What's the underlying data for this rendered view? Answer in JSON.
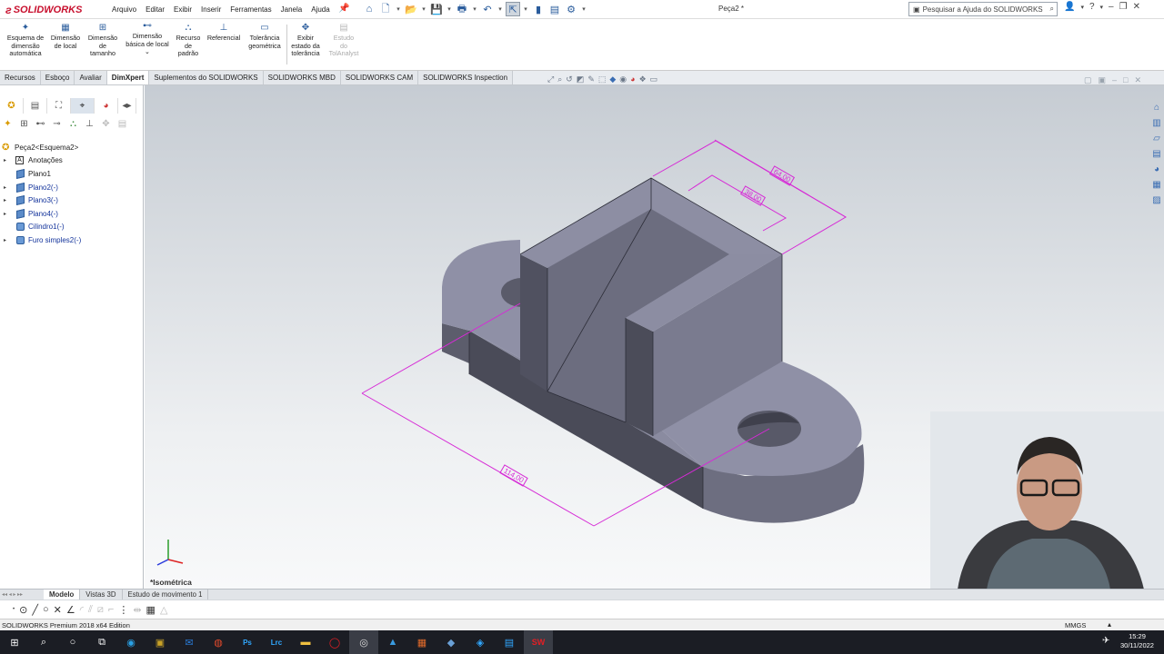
{
  "app": {
    "brand": "SOLIDWORKS",
    "doc_title": "Peça2 *",
    "search_placeholder": "Pesquisar a Ajuda do SOLIDWORKS"
  },
  "menus": [
    "Arquivo",
    "Editar",
    "Exibir",
    "Inserir",
    "Ferramentas",
    "Janela",
    "Ajuda"
  ],
  "commands": [
    {
      "label": "Esquema de dimensão automática",
      "lines": [
        "Esquema de",
        "dimensão",
        "automática"
      ],
      "icon": "auto-dimension-icon",
      "enabled": true
    },
    {
      "label": "Dimensão de local",
      "lines": [
        "Dimensão",
        "de local"
      ],
      "icon": "location-dimension-icon",
      "enabled": true
    },
    {
      "label": "Dimensão de tamanho",
      "lines": [
        "Dimensão",
        "de",
        "tamanho"
      ],
      "icon": "size-dimension-icon",
      "enabled": true
    },
    {
      "label": "Dimensão básica de local",
      "lines": [
        "Dimensão",
        "básica de local"
      ],
      "icon": "basic-location-dimension-icon",
      "enabled": true
    },
    {
      "label": "Recurso de padrão",
      "lines": [
        "Recurso",
        "de",
        "padrão"
      ],
      "icon": "pattern-feature-icon",
      "enabled": true
    },
    {
      "label": "Referencial",
      "lines": [
        "Referencial"
      ],
      "icon": "datum-icon",
      "enabled": true
    },
    {
      "label": "Tolerância geométrica",
      "lines": [
        "Tolerância",
        "geométrica"
      ],
      "icon": "geometric-tolerance-icon",
      "enabled": true
    },
    {
      "label": "Exibir estado da tolerância",
      "lines": [
        "Exibir",
        "estado da",
        "tolerância"
      ],
      "icon": "tolerance-status-icon",
      "enabled": true
    },
    {
      "label": "Estudo do TolAnalyst",
      "lines": [
        "Estudo",
        "do",
        "TolAnalyst"
      ],
      "icon": "tolanalyst-icon",
      "enabled": false
    }
  ],
  "tabs": [
    {
      "label": "Recursos",
      "active": false
    },
    {
      "label": "Esboço",
      "active": false
    },
    {
      "label": "Avaliar",
      "active": false
    },
    {
      "label": "DimXpert",
      "active": true
    },
    {
      "label": "Suplementos do SOLIDWORKS",
      "active": false
    },
    {
      "label": "SOLIDWORKS MBD",
      "active": false
    },
    {
      "label": "SOLIDWORKS CAM",
      "active": false
    },
    {
      "label": "SOLIDWORKS Inspection",
      "active": false
    }
  ],
  "tree": {
    "root": "Peça2<Esquema2>",
    "items": [
      {
        "label": "Anotações",
        "icon": "annotations-icon",
        "expandable": true
      },
      {
        "label": "Plano1",
        "icon": "plane-icon",
        "expandable": false
      },
      {
        "label": "Plano2(-)",
        "icon": "plane-icon",
        "expandable": true
      },
      {
        "label": "Plano3(-)",
        "icon": "plane-icon",
        "expandable": true
      },
      {
        "label": "Plano4(-)",
        "icon": "plane-icon",
        "expandable": true
      },
      {
        "label": "Cilindro1(-)",
        "icon": "cylinder-icon",
        "expandable": false
      },
      {
        "label": "Furo simples2(-)",
        "icon": "hole-icon",
        "expandable": true
      }
    ]
  },
  "viewport": {
    "view_name": "*Isométrica",
    "dimensions": [
      "64,00",
      "38,00",
      "114,00"
    ],
    "model_colors": {
      "top": "#8e8fa4",
      "side_dark": "#4b4c58",
      "front": "#6e6f80",
      "dim": "#d62ad6"
    }
  },
  "bottom_tabs": [
    {
      "label": "Modelo",
      "active": true
    },
    {
      "label": "Vistas 3D",
      "active": false
    },
    {
      "label": "Estudo de movimento 1",
      "active": false
    }
  ],
  "status": {
    "product": "SOLIDWORKS Premium 2018 x64 Edition",
    "units": "MMGS"
  },
  "clock": {
    "time": "15:29",
    "date": "30/11/2022"
  }
}
